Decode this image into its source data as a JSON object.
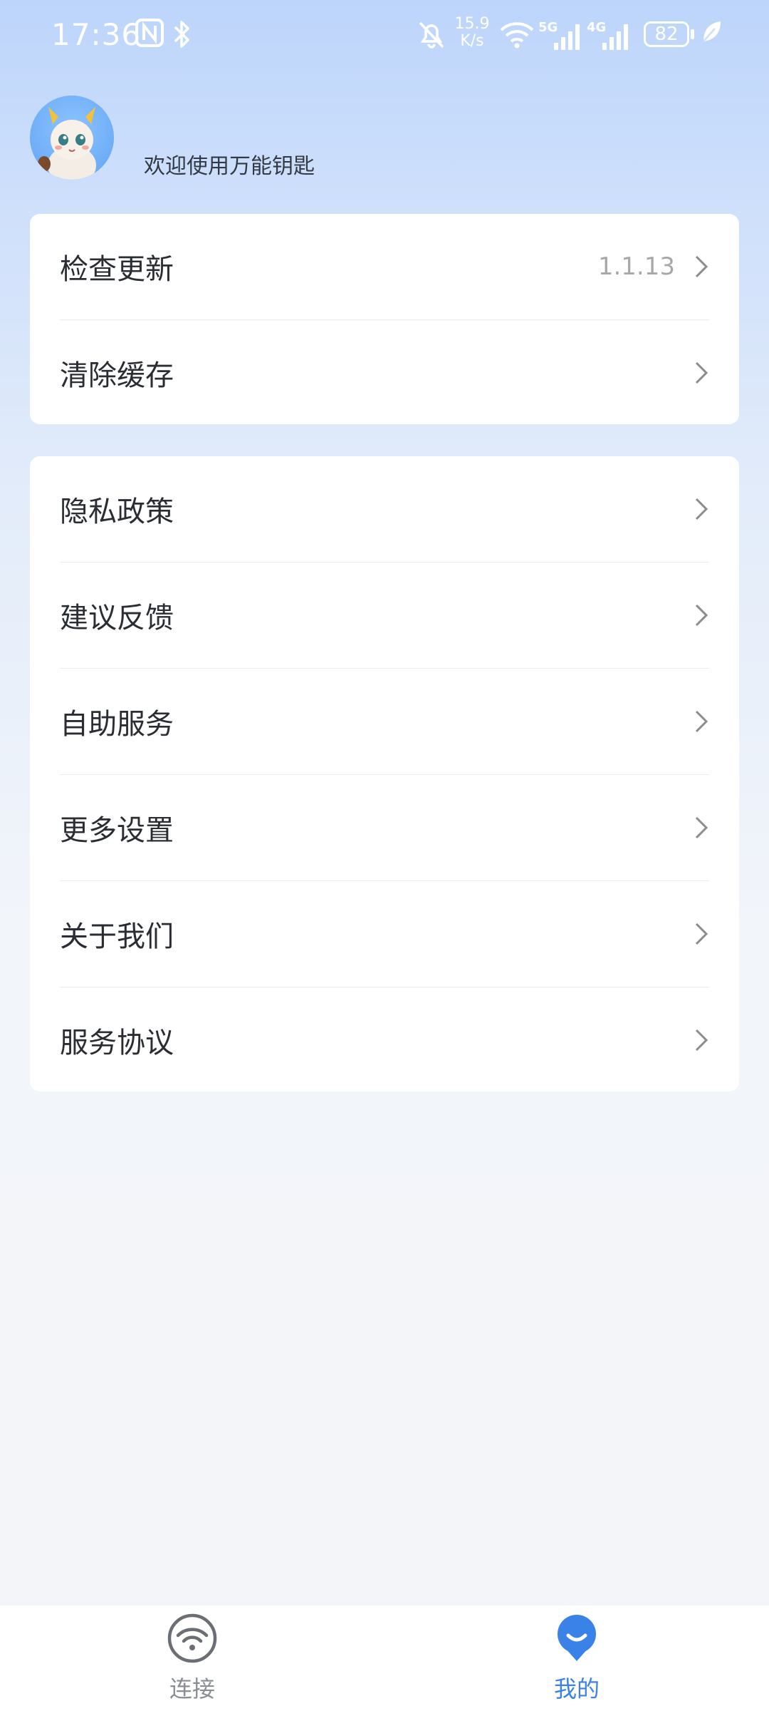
{
  "status_bar": {
    "time": "17:36",
    "net_speed_value": "15.9",
    "net_speed_unit": "K/s",
    "battery": "82",
    "icons": [
      "nfc-icon",
      "bluetooth-icon",
      "mute-icon",
      "wifi-icon",
      "signal-5g-icon",
      "signal-4g-icon",
      "battery-icon",
      "leaf-icon"
    ]
  },
  "profile": {
    "welcome": "欢迎使用万能钥匙"
  },
  "group1": [
    {
      "label": "检查更新",
      "value": "1.1.13"
    },
    {
      "label": "清除缓存",
      "value": ""
    }
  ],
  "group2": [
    {
      "label": "隐私政策"
    },
    {
      "label": "建议反馈"
    },
    {
      "label": "自助服务"
    },
    {
      "label": "更多设置"
    },
    {
      "label": "关于我们"
    },
    {
      "label": "服务协议"
    }
  ],
  "bottom_nav": {
    "connect": "连接",
    "mine": "我的",
    "active": "mine"
  },
  "colors": {
    "accent": "#3b82e8",
    "inactive": "#8a8d93"
  }
}
